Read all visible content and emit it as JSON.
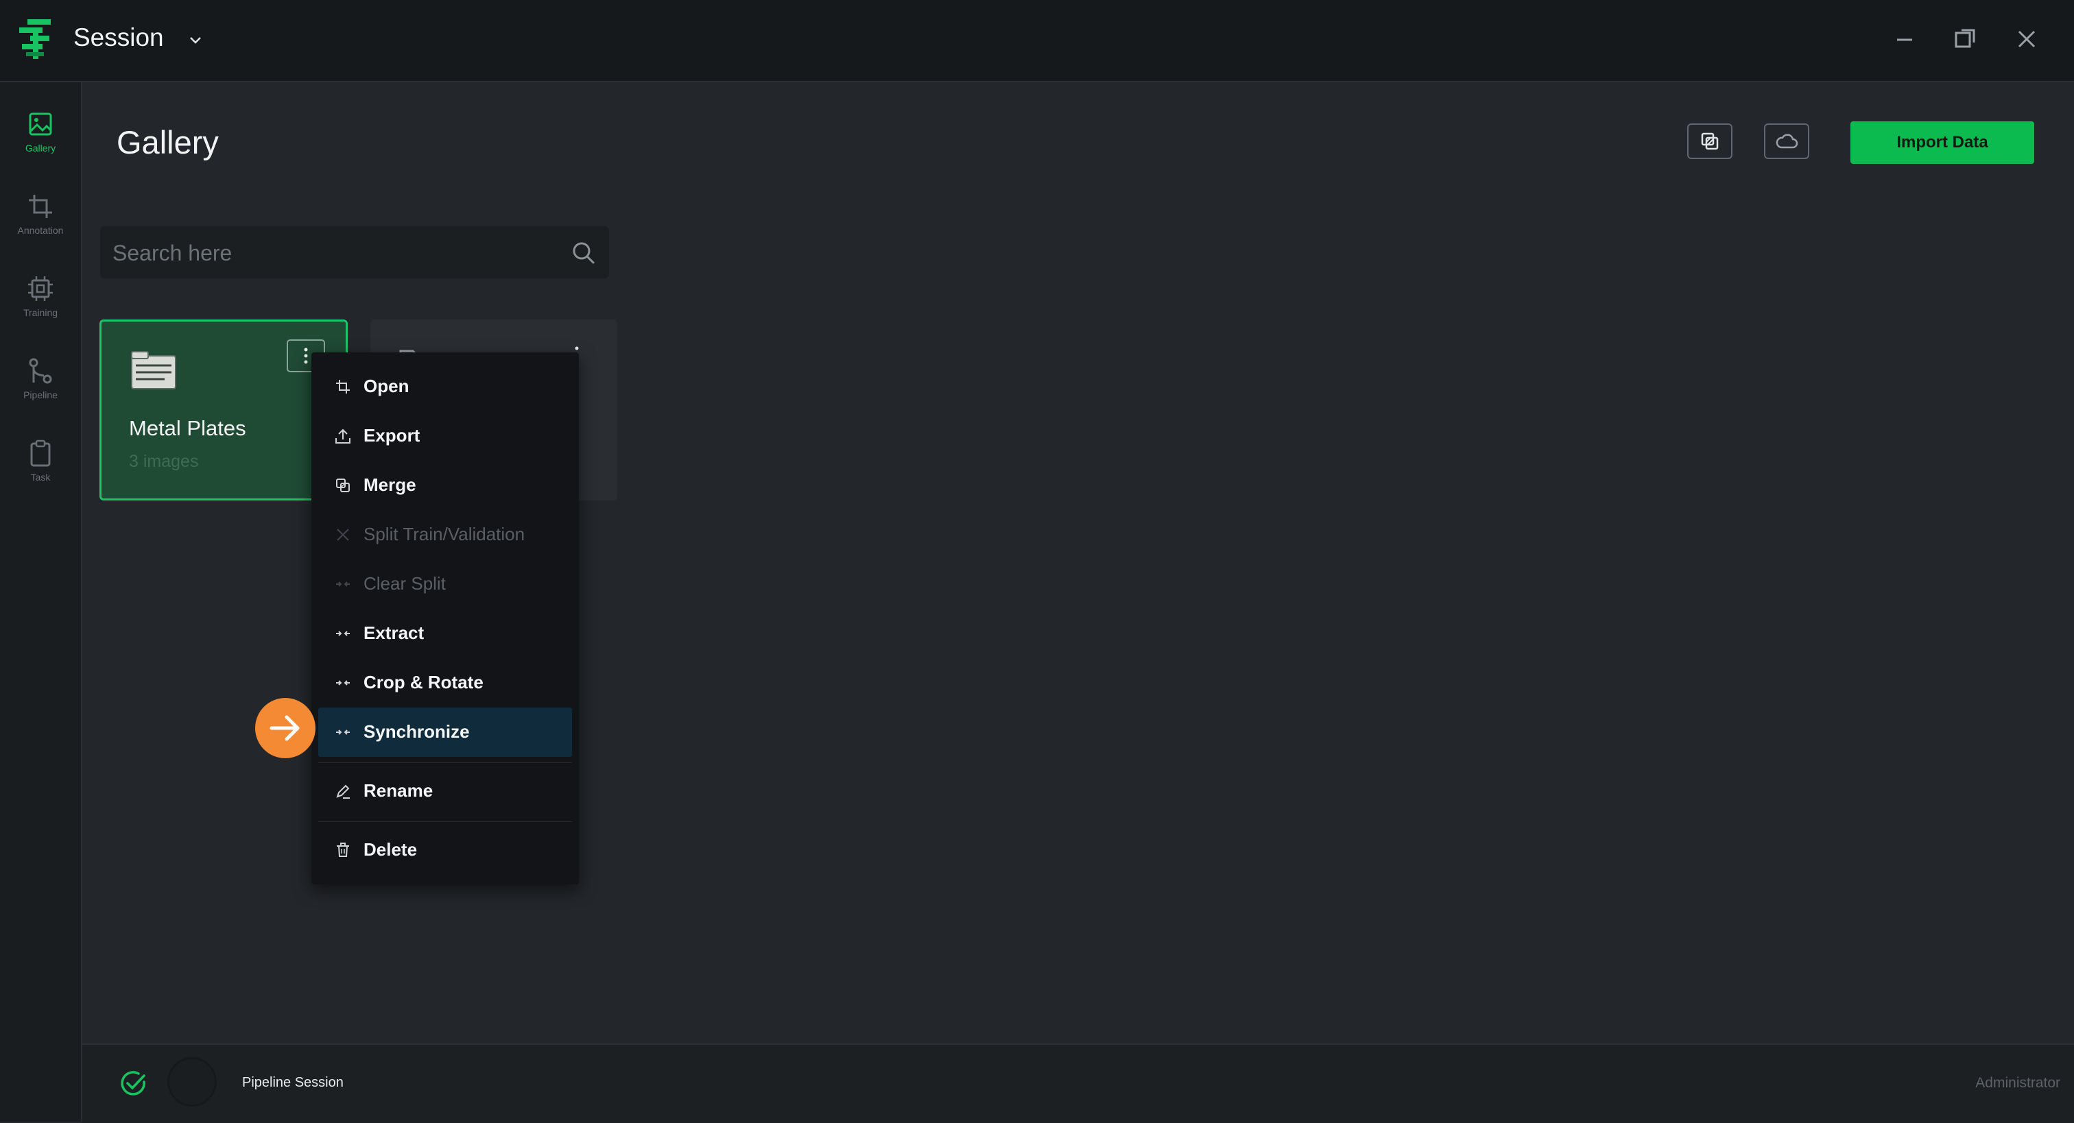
{
  "app": {
    "session_title": "Session"
  },
  "sidebar": {
    "items": [
      {
        "label": "Gallery",
        "icon": "image-icon",
        "active": true
      },
      {
        "label": "Annotation",
        "icon": "crop-icon"
      },
      {
        "label": "Training",
        "icon": "chip-icon"
      },
      {
        "label": "Pipeline",
        "icon": "git-branch-icon"
      },
      {
        "label": "Task",
        "icon": "clipboard-icon"
      }
    ]
  },
  "header": {
    "title": "Gallery",
    "import_label": "Import Data",
    "accent": "#0cbb4f"
  },
  "search": {
    "placeholder": "Search here"
  },
  "datasets": [
    {
      "name": "Metal Plates",
      "count": "3 images",
      "selected": true
    }
  ],
  "context_menu": {
    "items": [
      {
        "label": "Open",
        "icon": "crop-icon",
        "enabled": true
      },
      {
        "label": "Export",
        "icon": "upload-icon",
        "enabled": true
      },
      {
        "label": "Merge",
        "icon": "merge-icon",
        "enabled": true
      },
      {
        "label": "Split Train/Validation",
        "icon": "split-icon",
        "enabled": false
      },
      {
        "label": "Clear Split",
        "icon": "compress-icon",
        "enabled": false
      },
      {
        "label": "Extract",
        "icon": "compress-icon",
        "enabled": true
      },
      {
        "label": "Crop & Rotate",
        "icon": "compress-icon",
        "enabled": true
      },
      {
        "label": "Synchronize",
        "icon": "compress-icon",
        "enabled": true,
        "highlighted": true
      },
      {
        "label": "Rename",
        "icon": "pencil-icon",
        "enabled": true
      },
      {
        "label": "Delete",
        "icon": "trash-icon",
        "enabled": true
      }
    ]
  },
  "statusbar": {
    "session_name": "Pipeline Session",
    "user": "Administrator"
  }
}
